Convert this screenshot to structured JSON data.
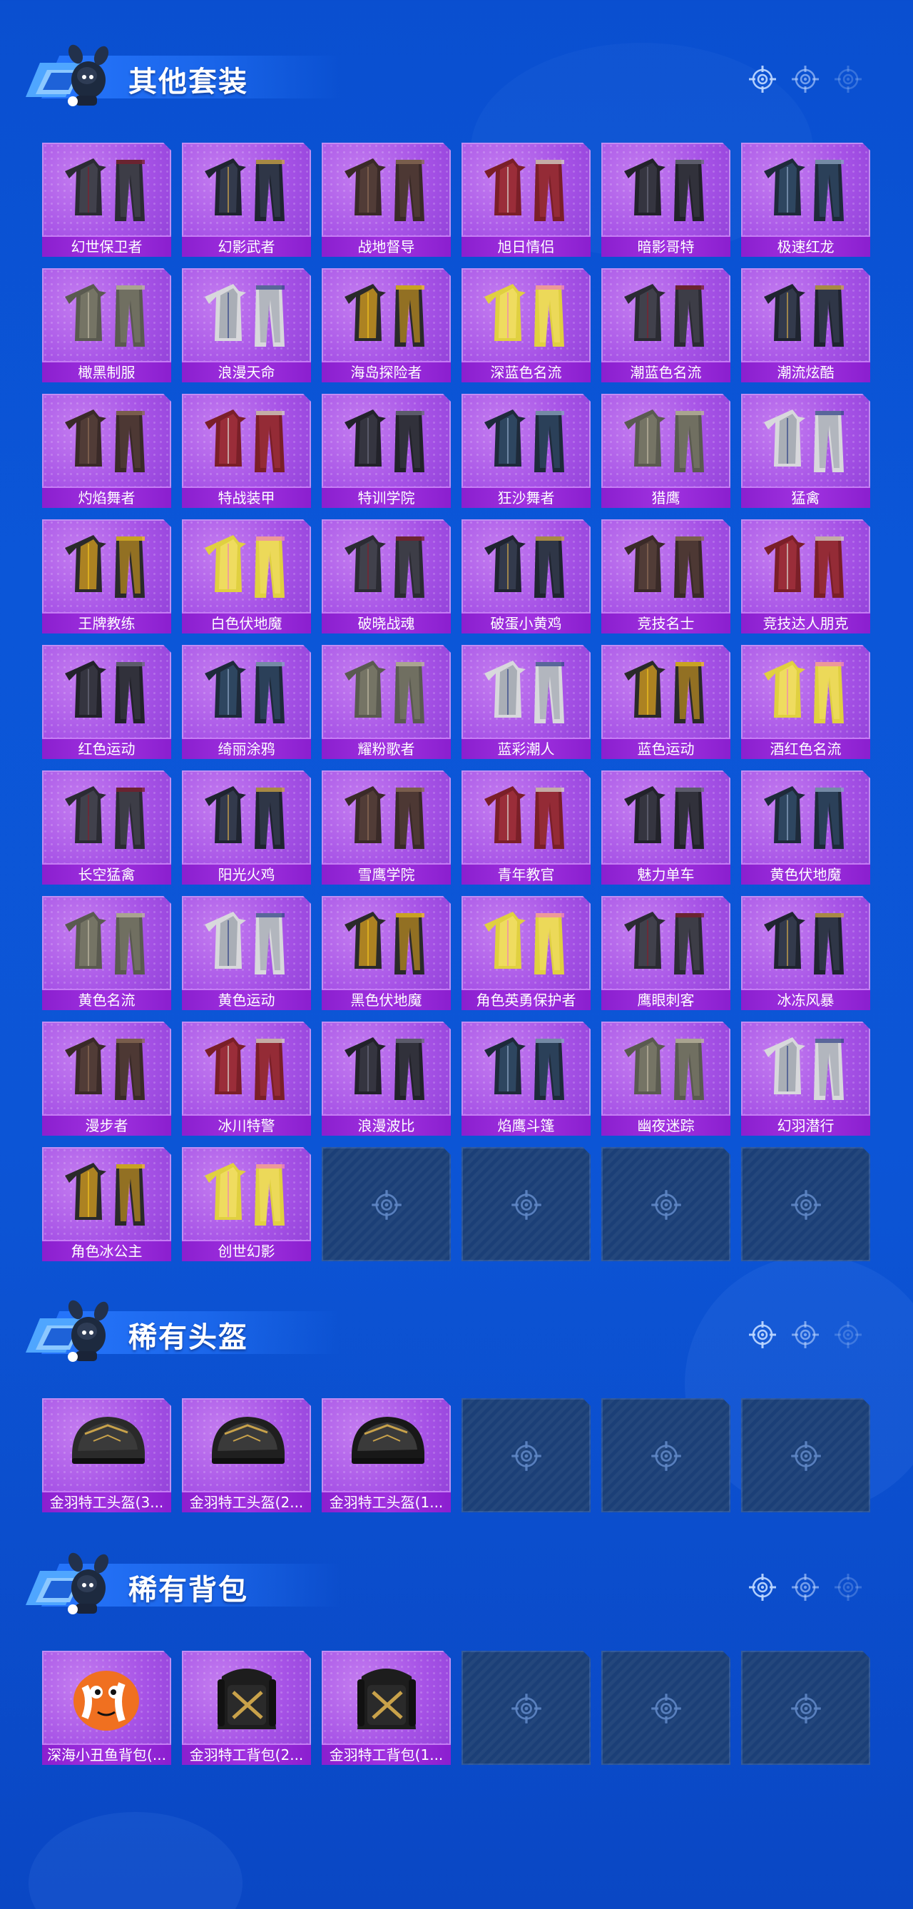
{
  "sections": [
    {
      "title": "其他套装",
      "items": [
        "幻世保卫者",
        "幻影武者",
        "战地督导",
        "旭日情侣",
        "暗影哥特",
        "极速红龙",
        "橄黑制服",
        "浪漫天命",
        "海岛探险者",
        "深蓝色名流",
        "潮蓝色名流",
        "潮流炫酷",
        "灼焰舞者",
        "特战装甲",
        "特训学院",
        "狂沙舞者",
        "猎鹰",
        "猛禽",
        "王牌教练",
        "白色伏地魔",
        "破晓战魂",
        "破蛋小黄鸡",
        "竞技名士",
        "竞技达人朋克",
        "红色运动",
        "绮丽涂鸦",
        "耀粉歌者",
        "蓝彩潮人",
        "蓝色运动",
        "酒红色名流",
        "长空猛禽",
        "阳光火鸡",
        "雪鹰学院",
        "青年教官",
        "魅力单车",
        "黄色伏地魔",
        "黄色名流",
        "黄色运动",
        "黑色伏地魔",
        "角色英勇保护者",
        "鹰眼刺客",
        "冰冻风暴",
        "漫步者",
        "冰川特警",
        "浪漫波比",
        "焰鹰斗篷",
        "幽夜迷踪",
        "幻羽潜行",
        "角色冰公主",
        "创世幻影"
      ],
      "empty_slots": 4
    },
    {
      "title": "稀有头盔",
      "items": [
        "金羽特工头盔(3...",
        "金羽特工头盔(2...",
        "金羽特工头盔(1..."
      ],
      "empty_slots": 3
    },
    {
      "title": "稀有背包",
      "items": [
        "深海小丑鱼背包(...",
        "金羽特工背包(2...",
        "金羽特工背包(1..."
      ],
      "empty_slots": 3
    }
  ],
  "icons": {
    "header_decor": "crosshair-icon",
    "empty_slot": "crosshair-icon",
    "mascot": "mascot-icon"
  },
  "colors": {
    "background": "#0b56d8",
    "card_fill": "#a652e6",
    "card_label": "#8b1fcf",
    "empty_card": "#1b3f77"
  }
}
